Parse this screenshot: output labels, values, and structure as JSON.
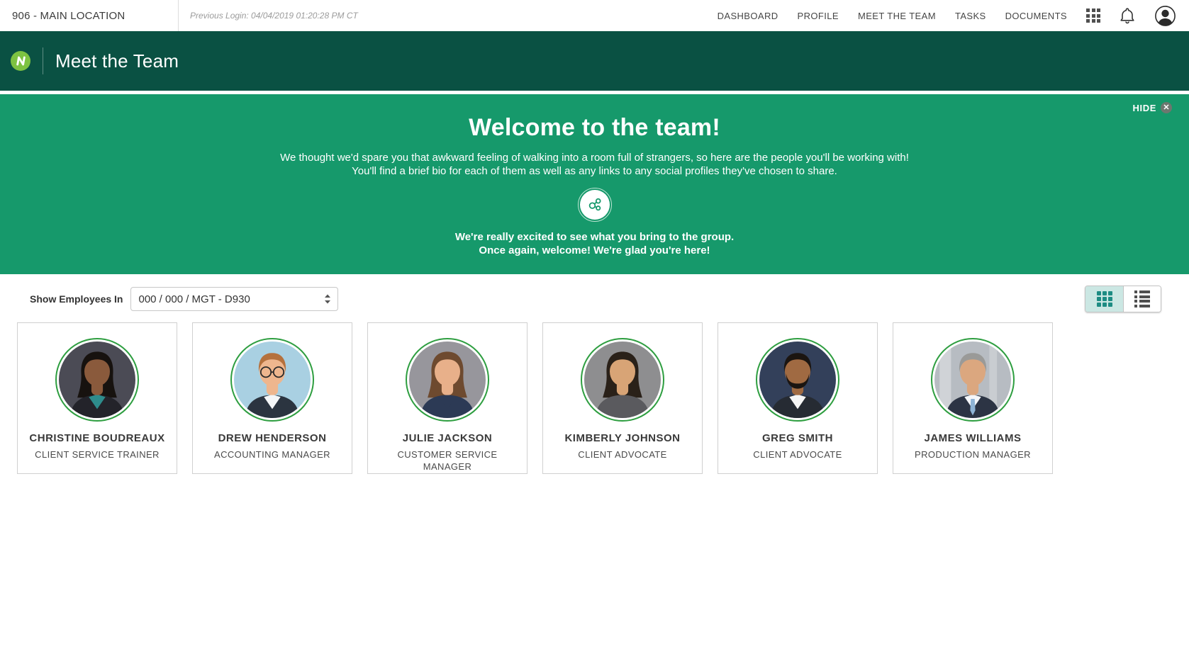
{
  "topbar": {
    "location": "906 - MAIN LOCATION",
    "previous_login": "Previous Login: 04/04/2019 01:20:28 PM CT",
    "nav": [
      "DASHBOARD",
      "PROFILE",
      "MEET THE TEAM",
      "TASKS",
      "DOCUMENTS"
    ],
    "icons": [
      "apps-grid-icon",
      "bell-icon",
      "user-avatar-icon"
    ]
  },
  "header": {
    "title": "Meet the Team",
    "logo": "netchex-logo"
  },
  "banner": {
    "hide_label": "HIDE",
    "title": "Welcome to the team!",
    "subtitle_line1": "We thought we'd spare you that awkward feeling of walking into a room full of strangers, so here are the people you'll be working with!",
    "subtitle_line2": "You'll find a brief bio for each of them as well as any links to any social profiles they've chosen to share.",
    "icon": "share-nodes-icon",
    "excited_line1": "We're really excited to see what you bring to the group.",
    "excited_line2": "Once again, welcome! We're glad you're here!"
  },
  "controls": {
    "label": "Show Employees In",
    "selected_option": "000 / 000 / MGT - D930"
  },
  "view_toggle": {
    "options": [
      "grid",
      "list"
    ],
    "active": "grid"
  },
  "employees": [
    {
      "name": "CHRISTINE BOUDREAUX",
      "title": "CLIENT SERVICE TRAINER",
      "photo": {
        "bg": "#4b4b55",
        "skin": "#8a5a3c",
        "hair": "#17120f",
        "suit": "#23232a",
        "shirt": "#2e8c8c",
        "hairstyle": "long",
        "features": []
      }
    },
    {
      "name": "DREW HENDERSON",
      "title": "ACCOUNTING MANAGER",
      "photo": {
        "bg": "#a9d0e2",
        "skin": "#eeb68e",
        "hair": "#b5713d",
        "suit": "#2b3440",
        "shirt": "#f4f6f8",
        "hairstyle": "short",
        "features": [
          "glasses"
        ]
      }
    },
    {
      "name": "JULIE JACKSON",
      "title": "CUSTOMER SERVICE MANAGER",
      "photo": {
        "bg": "#97969c",
        "skin": "#e8b08a",
        "hair": "#6e4a2f",
        "suit": "#2c3a55",
        "shirt": "#2c3a55",
        "hairstyle": "long",
        "features": []
      }
    },
    {
      "name": "KIMBERLY JOHNSON",
      "title": "CLIENT ADVOCATE",
      "photo": {
        "bg": "#8e8e90",
        "skin": "#d8a476",
        "hair": "#2a2119",
        "suit": "#5a5a5e",
        "shirt": "#5a5a5e",
        "hairstyle": "long",
        "features": []
      }
    },
    {
      "name": "GREG SMITH",
      "title": "CLIENT ADVOCATE",
      "photo": {
        "bg": "#33405a",
        "skin": "#a06a42",
        "hair": "#1b1511",
        "suit": "#262b33",
        "shirt": "#f5f5f5",
        "hairstyle": "short",
        "features": [
          "beard"
        ]
      }
    },
    {
      "name": "JAMES WILLIAMS",
      "title": "PRODUCTION MANAGER",
      "photo": {
        "bg": "#b7bcc2",
        "skin": "#dba77f",
        "hair": "#9a9a98",
        "suit": "#2c3444",
        "shirt": "#f5f7fa",
        "tie": "#8fb4d6",
        "hairstyle": "short",
        "features": [
          "tie",
          "office"
        ]
      }
    }
  ],
  "colors": {
    "header_bg": "#0A5143",
    "banner_bg": "#16996B",
    "logo_green": "#7DC242",
    "photo_ring_green": "#2E9E40",
    "toggle_active_bg": "#CBE7E3",
    "toggle_icon_teal": "#1D8C83"
  }
}
